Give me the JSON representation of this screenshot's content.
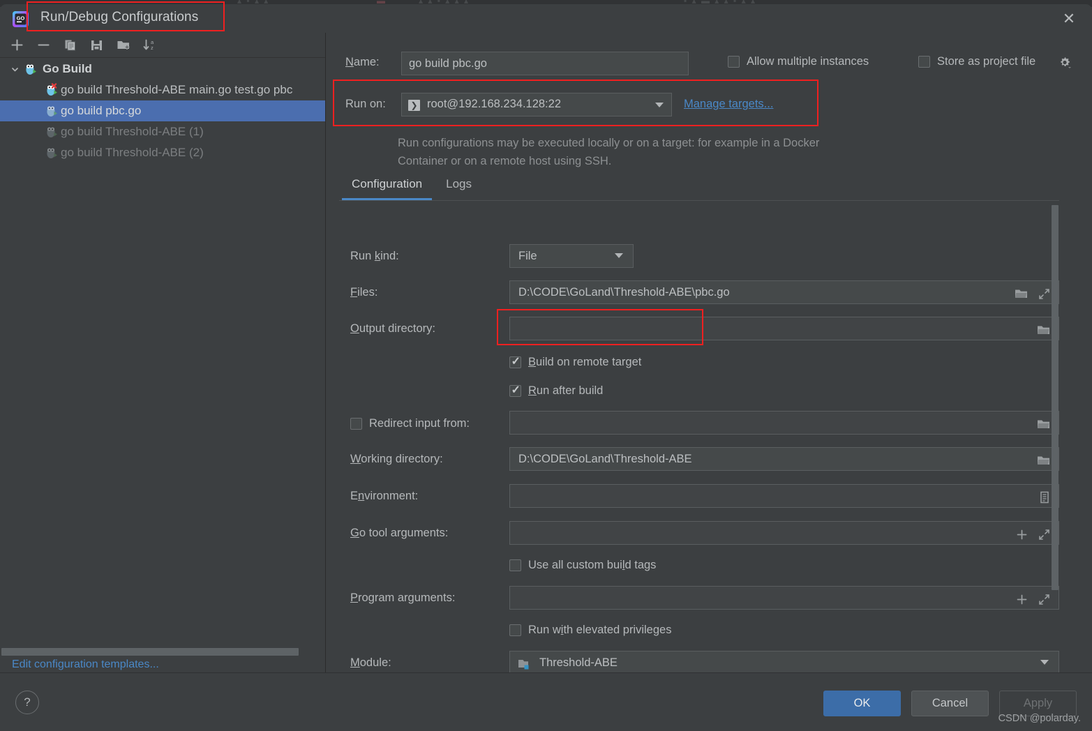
{
  "window": {
    "title": "Run/Debug Configurations",
    "close_icon": "close-icon",
    "app_icon": "goland-logo"
  },
  "toolbar": {
    "buttons": [
      {
        "name": "add",
        "icon": "plus-icon"
      },
      {
        "name": "remove",
        "icon": "minus-icon"
      },
      {
        "name": "copy",
        "icon": "copy-icon"
      },
      {
        "name": "save",
        "icon": "save-icon"
      },
      {
        "name": "new-folder",
        "icon": "folder-plus-icon"
      },
      {
        "name": "sort",
        "icon": "sort-az-icon"
      }
    ]
  },
  "tree": {
    "group": {
      "label": "Go Build",
      "expanded": true,
      "chevron": "chevron-down-icon"
    },
    "items": [
      {
        "label": "go build Threshold-ABE main.go test.go pbc",
        "state": "error",
        "selected": false
      },
      {
        "label": "go build pbc.go",
        "state": "normal",
        "selected": true
      },
      {
        "label": "go build Threshold-ABE (1)",
        "state": "dim",
        "selected": false
      },
      {
        "label": "go build Threshold-ABE (2)",
        "state": "dim",
        "selected": false
      }
    ],
    "edit_templates_link": "Edit configuration templates..."
  },
  "header": {
    "name_label": "Name:",
    "name_value": "go build pbc.go",
    "allow_multiple_instances": {
      "label": "Allow multiple instances",
      "checked": false
    },
    "store_as_project_file": {
      "label": "Store as project file",
      "checked": false
    },
    "gear_icon": "gear-icon"
  },
  "run_on": {
    "label": "Run on:",
    "value": "root@192.168.234.128:22",
    "target_icon": "remote-target-icon",
    "manage_link": "Manage targets...",
    "hint": "Run configurations may be executed locally or on a target: for example in a Docker Container or on a remote host using SSH."
  },
  "tabs": [
    {
      "label": "Configuration",
      "active": true
    },
    {
      "label": "Logs",
      "active": false
    }
  ],
  "configuration": {
    "run_kind": {
      "label": "Run kind:",
      "value": "File"
    },
    "files": {
      "label": "Files:",
      "value": "D:\\CODE\\GoLand\\Threshold-ABE\\pbc.go",
      "icons": [
        "folder-icon",
        "expand-icon"
      ]
    },
    "output_directory": {
      "label": "Output directory:",
      "value": "",
      "icons": [
        "folder-icon"
      ]
    },
    "build_on_remote_target": {
      "label": "Build on remote target",
      "checked": true
    },
    "run_after_build": {
      "label": "Run after build",
      "checked": true
    },
    "redirect_input_from": {
      "label": "Redirect input from:",
      "checked": false,
      "value": "",
      "icons": [
        "folder-icon"
      ]
    },
    "working_directory": {
      "label": "Working directory:",
      "value": "D:\\CODE\\GoLand\\Threshold-ABE",
      "icons": [
        "folder-icon"
      ]
    },
    "environment": {
      "label": "Environment:",
      "value": "",
      "icons": [
        "list-icon"
      ]
    },
    "go_tool_arguments": {
      "label": "Go tool arguments:",
      "value": "",
      "icons": [
        "plus-icon",
        "expand-icon"
      ]
    },
    "use_all_custom_build_tags": {
      "label": "Use all custom build tags",
      "checked": false
    },
    "program_arguments": {
      "label": "Program arguments:",
      "value": "",
      "icons": [
        "plus-icon",
        "expand-icon"
      ]
    },
    "run_with_elevated_privileges": {
      "label": "Run with elevated privileges",
      "checked": false
    },
    "module": {
      "label": "Module:",
      "value": "Threshold-ABE",
      "icon": "module-icon"
    }
  },
  "footer": {
    "help_icon": "question-mark-icon",
    "ok": "OK",
    "cancel": "Cancel",
    "apply": "Apply",
    "watermark": "CSDN @polarday."
  },
  "colors": {
    "background": "#3c3f41",
    "field": "#45494a",
    "selection": "#4b6eaf",
    "link": "#4a88c7",
    "accent": "#3c6da8",
    "highlight": "#ef2020"
  }
}
